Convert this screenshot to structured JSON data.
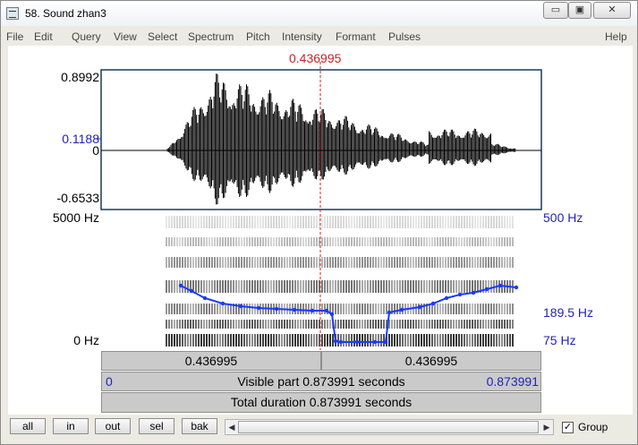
{
  "window": {
    "title": "58. Sound zhan3"
  },
  "menu": [
    "File",
    "Edit",
    "Query",
    "View",
    "Select",
    "Spectrum",
    "Pitch",
    "Intensity",
    "Formant",
    "Pulses"
  ],
  "help": "Help",
  "cursor": {
    "time_label": "0.436995"
  },
  "waveform": {
    "ymax": "0.8992",
    "yzero": "0",
    "ymin": "-0.6533",
    "ycursor": "0.1188"
  },
  "spectrogram": {
    "fmax": "5000 Hz",
    "fmin": "0 Hz"
  },
  "pitch": {
    "max": "500 Hz",
    "value": "189.5 Hz",
    "min": "75 Hz"
  },
  "bars": {
    "left": "0.436995",
    "right": "0.436995",
    "visible_start": "0",
    "visible_text": "Visible part 0.873991 seconds",
    "visible_end": "0.873991",
    "total_text": "Total duration 0.873991 seconds"
  },
  "buttons": [
    "all",
    "in",
    "out",
    "sel",
    "bak"
  ],
  "group": {
    "label": "Group",
    "checked": true
  },
  "colors": {
    "cursor": "#cc2222",
    "pitch": "#1a3aff",
    "axis_blue": "#2222bb"
  }
}
